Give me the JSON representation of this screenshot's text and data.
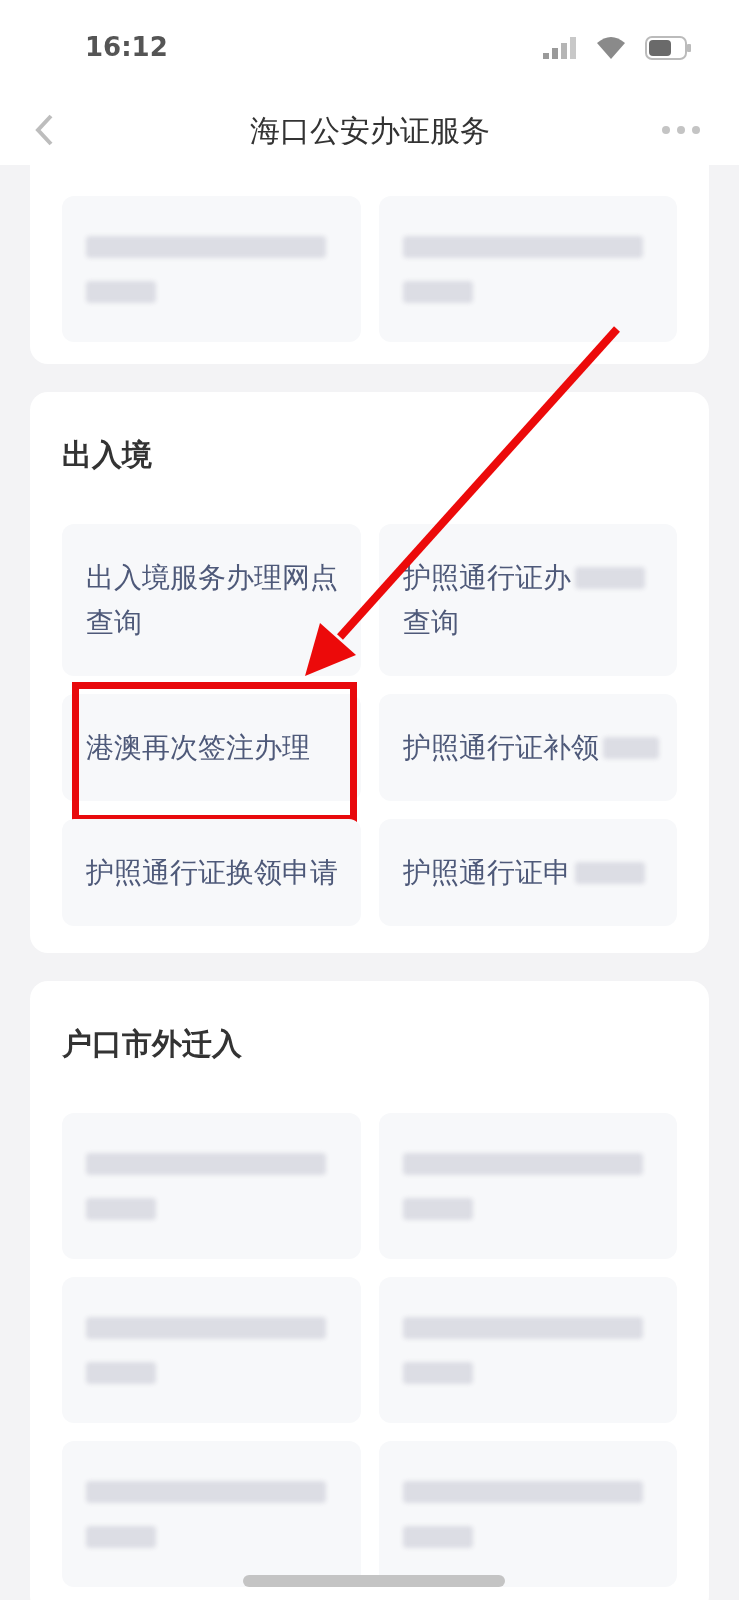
{
  "status_bar": {
    "time": "16:12"
  },
  "nav_bar": {
    "title": "海口公安办证服务"
  },
  "sections": [
    {
      "tiles": [
        {
          "kind": "blurred"
        },
        {
          "kind": "blurred"
        }
      ]
    },
    {
      "title": "出入境",
      "tiles": [
        {
          "kind": "text",
          "text": "出入境服务办理网点查询",
          "highlighted": false
        },
        {
          "kind": "partly_blurred",
          "lines": [
            {
              "text": "护照通行证办",
              "blurred_tail": true
            },
            {
              "text": "查询",
              "blurred_tail": false
            }
          ],
          "highlighted": false
        },
        {
          "kind": "text",
          "text": "港澳再次签注办理",
          "highlighted": true
        },
        {
          "kind": "partly_blurred",
          "lines": [
            {
              "text": "护照通行证补领",
              "blurred_tail": true
            }
          ],
          "highlighted": false
        },
        {
          "kind": "text",
          "text": "护照通行证换领申请",
          "highlighted": false
        },
        {
          "kind": "partly_blurred",
          "lines": [
            {
              "text": "护照通行证申",
              "blurred_tail": true
            }
          ],
          "highlighted": false
        }
      ]
    },
    {
      "title": "户口市外迁入",
      "tiles": [
        {
          "kind": "blurred"
        },
        {
          "kind": "blurred"
        },
        {
          "kind": "blurred"
        },
        {
          "kind": "blurred"
        },
        {
          "kind": "blurred"
        },
        {
          "kind": "blurred"
        }
      ]
    }
  ],
  "annotations": [
    {
      "kind": "arrow"
    }
  ]
}
